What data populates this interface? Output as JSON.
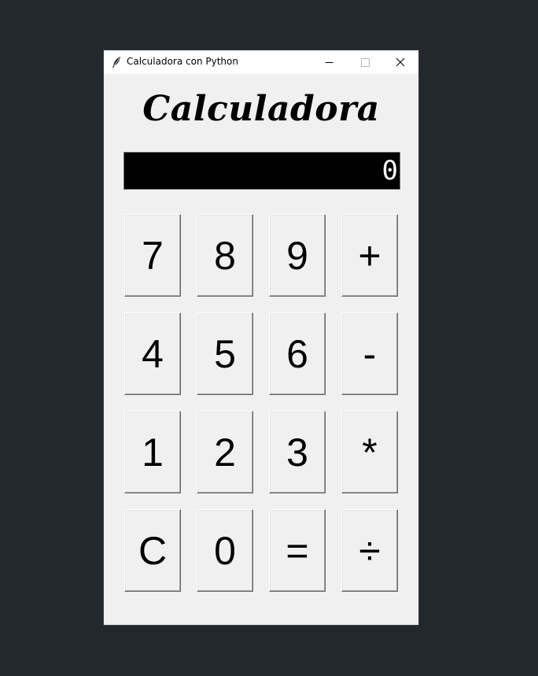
{
  "window": {
    "title": "Calculadora con Python",
    "app_icon": "feather-icon",
    "controls": {
      "minimize_icon": "minimize-icon",
      "maximize_icon": "maximize-icon",
      "close_icon": "close-icon"
    }
  },
  "app": {
    "heading": "Calculadora",
    "display_value": "0"
  },
  "keypad": {
    "rows": [
      [
        "7",
        "8",
        "9",
        "+"
      ],
      [
        "4",
        "5",
        "6",
        "-"
      ],
      [
        "1",
        "2",
        "3",
        "*"
      ],
      [
        "C",
        "0",
        "=",
        "÷"
      ]
    ]
  },
  "colors": {
    "desktop": "#23272e",
    "window_bg": "#f0f0f0",
    "titlebar_bg": "#ffffff",
    "display_bg": "#000000",
    "display_fg": "#ffffff"
  }
}
